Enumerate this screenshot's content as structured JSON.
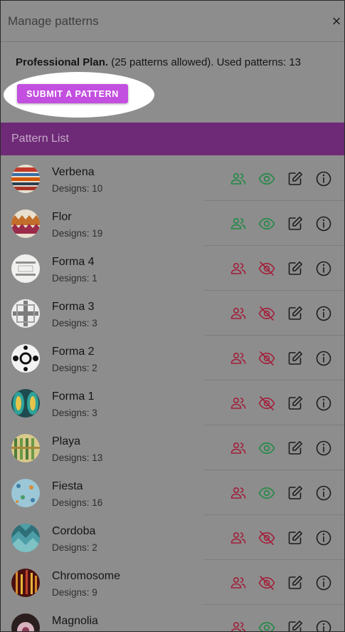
{
  "dialog": {
    "title": "Manage patterns",
    "close_label": "×"
  },
  "plan": {
    "name": "Professional Plan.",
    "details": " (25 patterns allowed). Used patterns: 13"
  },
  "submit_label": "SUBMIT A PATTERN",
  "list_title": "Pattern List",
  "colors": {
    "header_purple": "#6e2a77",
    "button_purple": "#c34fe0",
    "shared_green": "#1f8a44",
    "private_red": "#a31f3a"
  },
  "patterns": [
    {
      "name": "Verbena",
      "designs": "Designs: 10",
      "shared": true,
      "visible": true
    },
    {
      "name": "Flor",
      "designs": "Designs: 19",
      "shared": true,
      "visible": true
    },
    {
      "name": "Forma 4",
      "designs": "Designs: 1",
      "shared": false,
      "visible": false
    },
    {
      "name": "Forma 3",
      "designs": "Designs: 3",
      "shared": false,
      "visible": false
    },
    {
      "name": "Forma 2",
      "designs": "Designs: 2",
      "shared": false,
      "visible": false
    },
    {
      "name": "Forma 1",
      "designs": "Designs: 3",
      "shared": false,
      "visible": false
    },
    {
      "name": "Playa",
      "designs": "Designs: 13",
      "shared": false,
      "visible": true
    },
    {
      "name": "Fiesta",
      "designs": "Designs: 16",
      "shared": false,
      "visible": true
    },
    {
      "name": "Cordoba",
      "designs": "Designs: 2",
      "shared": false,
      "visible": false
    },
    {
      "name": "Chromosome",
      "designs": "Designs: 9",
      "shared": false,
      "visible": false
    },
    {
      "name": "Magnolia",
      "designs": "",
      "shared": false,
      "visible": true
    }
  ]
}
